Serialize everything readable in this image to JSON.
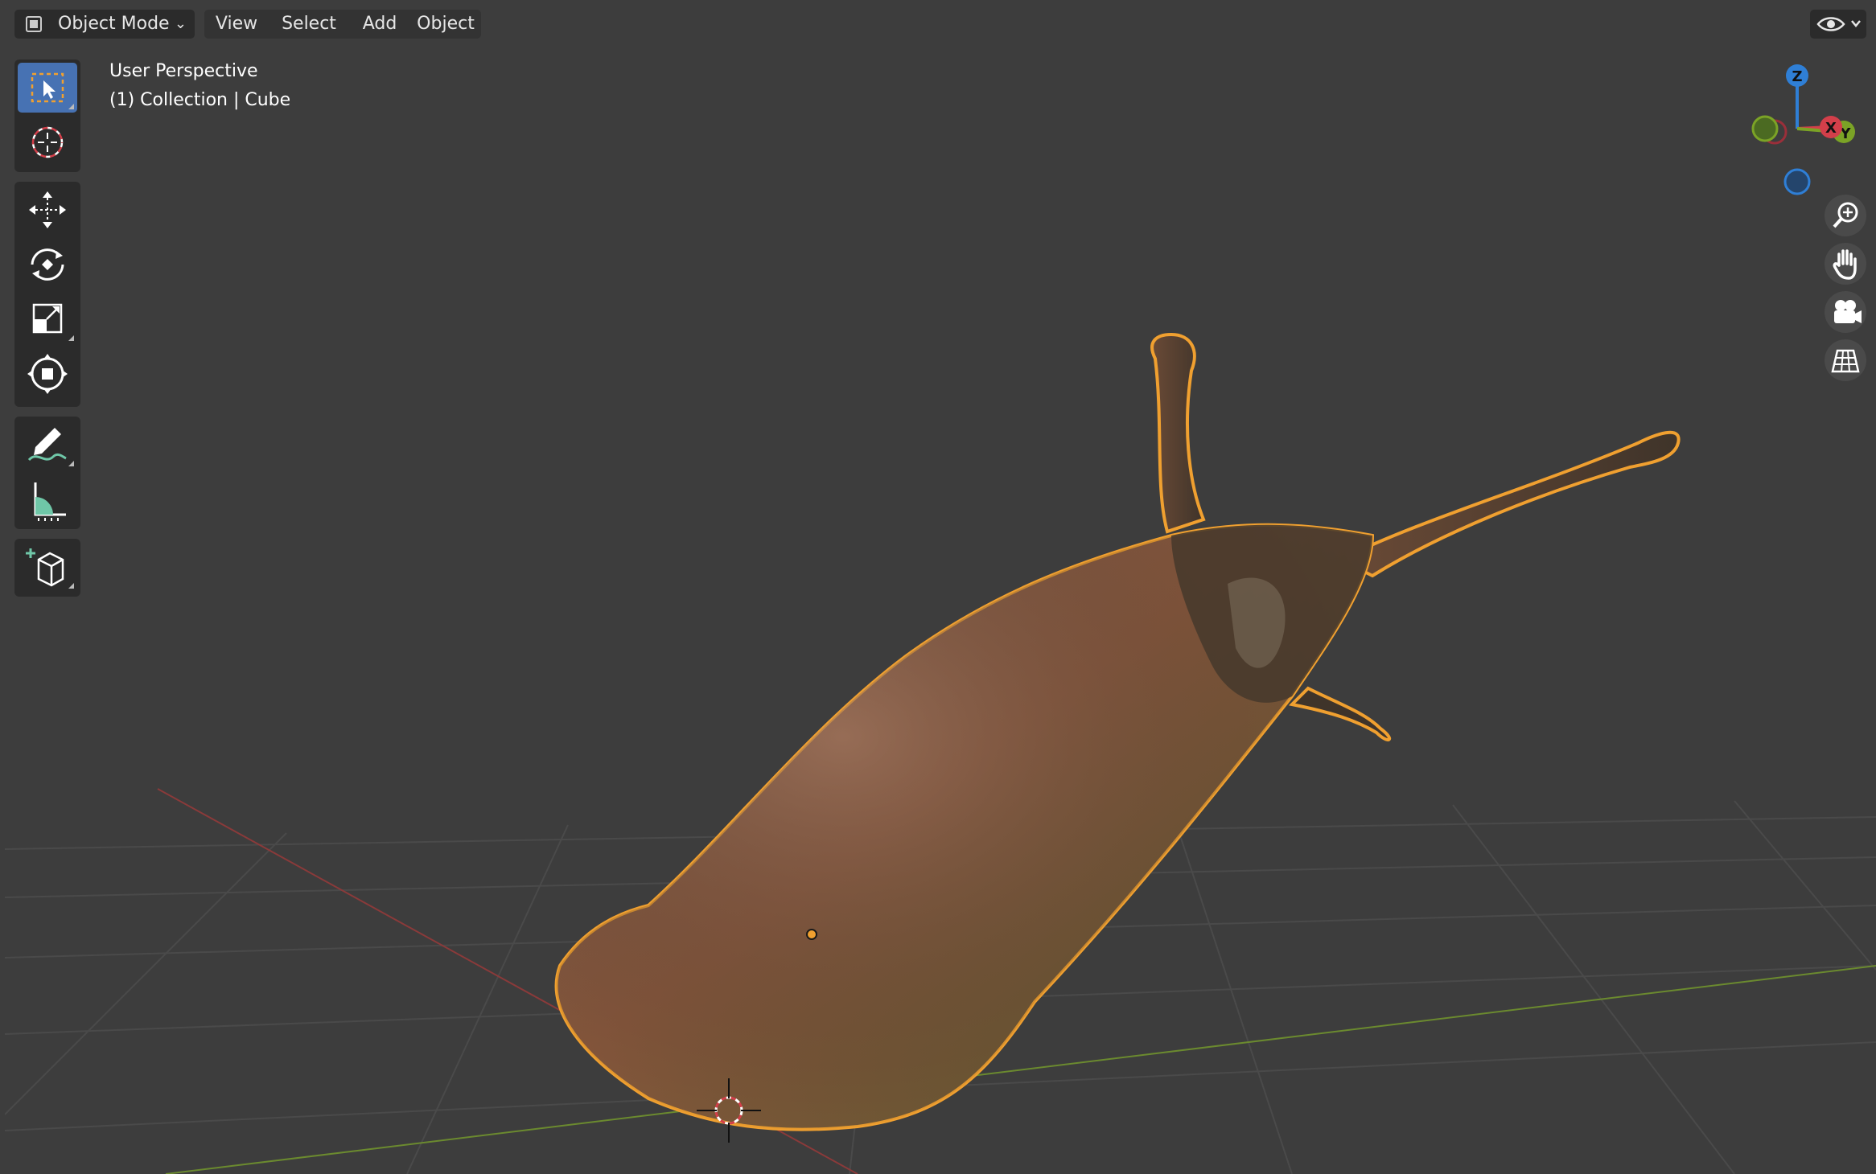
{
  "header": {
    "mode_label": "Object Mode",
    "menus": [
      "View",
      "Select",
      "Add",
      "Object"
    ]
  },
  "overlay": {
    "view_name": "User Perspective",
    "collection_info": "(1) Collection | Cube"
  },
  "gizmo": {
    "z_label": "Z",
    "x_label": "X",
    "y_label": "Y"
  },
  "toolbar": {
    "tools": [
      "select-box",
      "cursor",
      "move",
      "rotate",
      "scale",
      "transform",
      "annotate",
      "measure",
      "add-cube"
    ],
    "active_tool": "select-box"
  },
  "colors": {
    "viewport_bg": "#3d3d3d",
    "selection_outline": "#f0a030",
    "active_tool": "#4772b3",
    "axis_x": "#d33f4a",
    "axis_y": "#7ba326",
    "axis_z": "#2f7fd6"
  },
  "icons": {
    "visibility": "eye-icon",
    "zoom": "zoom-icon",
    "pan": "hand-icon",
    "camera": "camera-icon",
    "perspective": "grid-icon"
  }
}
